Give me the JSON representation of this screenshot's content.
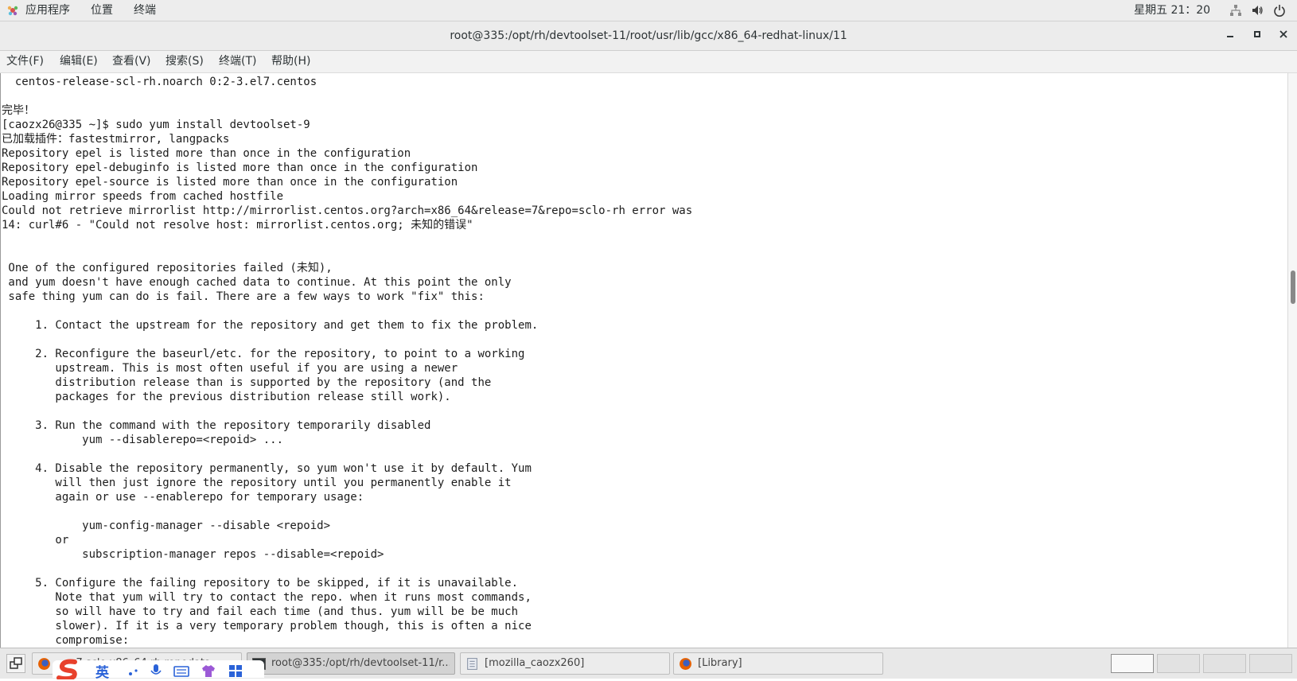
{
  "top_panel": {
    "applications": "应用程序",
    "places": "位置",
    "terminal": "终端",
    "clock": "星期五 21：20"
  },
  "window": {
    "title": "root@335:/opt/rh/devtoolset-11/root/usr/lib/gcc/x86_64-redhat-linux/11"
  },
  "menubar": [
    "文件(F)",
    "编辑(E)",
    "查看(V)",
    "搜索(S)",
    "终端(T)",
    "帮助(H)"
  ],
  "terminal": {
    "lines": [
      "  centos-release-scl-rh.noarch 0:2-3.el7.centos",
      "",
      "完毕！",
      "[caozx26@335 ~]$ sudo yum install devtoolset-9",
      "已加载插件：fastestmirror, langpacks",
      "Repository epel is listed more than once in the configuration",
      "Repository epel-debuginfo is listed more than once in the configuration",
      "Repository epel-source is listed more than once in the configuration",
      "Loading mirror speeds from cached hostfile",
      "Could not retrieve mirrorlist http://mirrorlist.centos.org?arch=x86_64&release=7&repo=sclo-rh error was",
      "14: curl#6 - \"Could not resolve host: mirrorlist.centos.org; 未知的错误\"",
      "",
      "",
      " One of the configured repositories failed (未知),",
      " and yum doesn't have enough cached data to continue. At this point the only",
      " safe thing yum can do is fail. There are a few ways to work \"fix\" this:",
      "",
      "     1. Contact the upstream for the repository and get them to fix the problem.",
      "",
      "     2. Reconfigure the baseurl/etc. for the repository, to point to a working",
      "        upstream. This is most often useful if you are using a newer",
      "        distribution release than is supported by the repository (and the",
      "        packages for the previous distribution release still work).",
      "",
      "     3. Run the command with the repository temporarily disabled",
      "            yum --disablerepo=<repoid> ...",
      "",
      "     4. Disable the repository permanently, so yum won't use it by default. Yum",
      "        will then just ignore the repository until you permanently enable it",
      "        again or use --enablerepo for temporary usage:",
      "",
      "            yum-config-manager --disable <repoid>",
      "        or",
      "            subscription-manager repos --disable=<repoid>",
      "",
      "     5. Configure the failing repository to be skipped, if it is unavailable.",
      "        Note that yum will try to contact the repo. when it runs most commands,",
      "        so will have to try and fail each time (and thus. yum will be be much",
      "        slower). If it is a very temporary problem though, this is often a nice",
      "        compromise:"
    ]
  },
  "taskbar": {
    "tasks": [
      {
        "label": "...e 7 sclo x86_64 rh repodata...",
        "icon": "firefox-icon"
      },
      {
        "label": "root@335:/opt/rh/devtoolset-11/r...",
        "icon": "terminal-icon"
      },
      {
        "label": "[mozilla_caozx260]",
        "icon": "document-icon"
      },
      {
        "label": "[Library]",
        "icon": "firefox-icon"
      }
    ],
    "ime_char": "英"
  },
  "colors": {
    "panel_bg": "#ededed",
    "terminal_bg": "#ffffff",
    "terminal_fg": "#1c1c1c",
    "ime_red": "#e8412c",
    "ime_blue": "#2a62d8"
  }
}
